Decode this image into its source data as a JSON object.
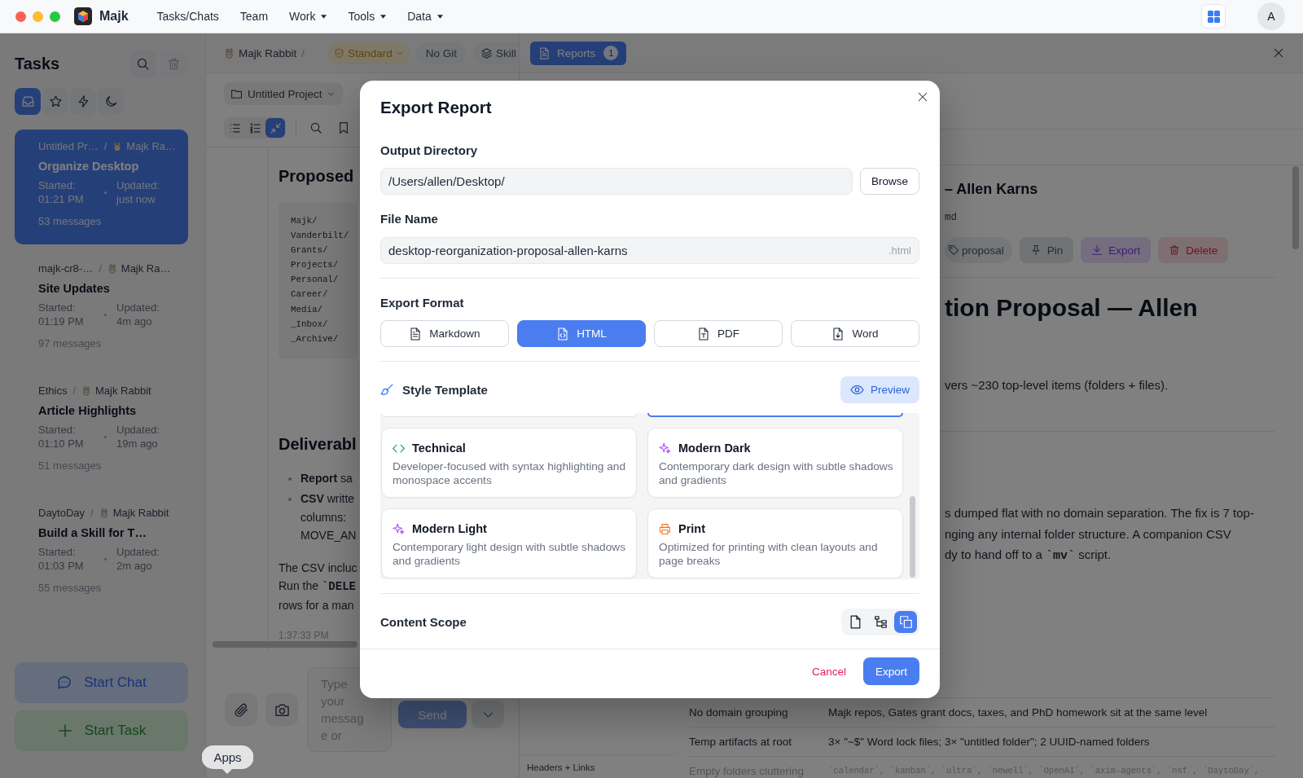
{
  "window": {
    "app_name": "Majk",
    "menu": [
      {
        "label": "Tasks/Chats",
        "dropdown": false
      },
      {
        "label": "Team",
        "dropdown": false
      },
      {
        "label": "Work",
        "dropdown": true
      },
      {
        "label": "Tools",
        "dropdown": true
      },
      {
        "label": "Data",
        "dropdown": true
      }
    ],
    "avatar": "A"
  },
  "sidebar": {
    "title": "Tasks",
    "header_actions": [
      {
        "kind": "search",
        "disabled": false
      },
      {
        "kind": "trash",
        "disabled": true
      }
    ],
    "filters": [
      {
        "kind": "tray",
        "selected": true
      },
      {
        "kind": "star",
        "selected": false
      },
      {
        "kind": "bolt",
        "selected": false
      },
      {
        "kind": "moon",
        "selected": false
      }
    ],
    "tasks": [
      {
        "project": "Untitled Pr…",
        "separator": "/",
        "agent": "Majk Ra…",
        "title": "Organize Desktop",
        "started": "Started: 01:21 PM",
        "updated": "Updated: just now",
        "messages": "53 messages",
        "selected": true
      },
      {
        "project": "majk-cr8-…",
        "separator": "/",
        "agent": "Majk Ra…",
        "title": "Site Updates",
        "started": "Started: 01:19 PM",
        "updated": "Updated: 4m ago",
        "messages": "97 messages",
        "selected": false
      },
      {
        "project": "Ethics",
        "separator": "/",
        "agent": "Majk Rabbit",
        "title": "Article Highlights",
        "started": "Started: 01:10 PM",
        "updated": "Updated: 19m ago",
        "messages": "51 messages",
        "selected": false
      },
      {
        "project": "DaytoDay",
        "separator": "/",
        "agent": "Majk Rabbit",
        "title": "Build a Skill for T…",
        "started": "Started: 01:03 PM",
        "updated": "Updated: 2m ago",
        "messages": "55 messages",
        "selected": false
      }
    ],
    "actions": [
      {
        "kind": "chat",
        "label": "Start Chat"
      },
      {
        "kind": "task",
        "label": "Start Task"
      }
    ]
  },
  "chat": {
    "breadcrumb": {
      "agent": "Majk Rabbit",
      "separator": "/"
    },
    "mode": "Standard",
    "pills": [
      {
        "kind": "git",
        "label": "No Git"
      },
      {
        "kind": "skill",
        "label": "Skill"
      }
    ],
    "project": "Untitled Project",
    "view_modes": [
      {
        "kind": "bullet-list",
        "selected": false
      },
      {
        "kind": "numbered-list",
        "selected": false
      },
      {
        "kind": "collapse",
        "selected": true
      }
    ],
    "tools": [
      {
        "kind": "search"
      },
      {
        "kind": "bookmark"
      }
    ],
    "message": {
      "heading": "Proposed",
      "code_lines": [
        "Majk/",
        "Vanderbilt/",
        "Grants/",
        "Projects/",
        "Personal/",
        "Career/",
        "Media/",
        "_Inbox/",
        "_Archive/"
      ],
      "subheading": "Deliverabl",
      "bullets": [
        {
          "lines": [
            "**Report** sa"
          ]
        },
        {
          "lines": [
            "**CSV** writte",
            "columns:",
            "MOVE_AN"
          ]
        }
      ],
      "paragraph_lines": [
        "The CSV incluc",
        "Run the **`DELE**",
        "rows for a man"
      ],
      "time": "1:37:33 PM"
    },
    "composer": {
      "placeholder": "Type your message or",
      "send": {
        "label": "Send",
        "disabled": true
      }
    }
  },
  "tooltip": "Apps",
  "reports": {
    "tab": {
      "label": "Reports",
      "count": "1",
      "selected": true
    },
    "title": "– Allen Karns",
    "file": "md",
    "actions": [
      {
        "kind": "tag",
        "label": "proposal"
      },
      {
        "kind": "pin",
        "label": "Pin"
      },
      {
        "kind": "export",
        "label": "Export"
      },
      {
        "kind": "delete",
        "label": "Delete"
      }
    ],
    "heading": "tion Proposal — Allen",
    "summary": "vers ~230 top-level items (folders + files).",
    "paragraph_lines": [
      "s dumped flat with no domain separation. The fix is 7 top-",
      "nging any internal folder structure. A companion CSV",
      "dy to hand off to a **`mv`** script."
    ],
    "table_rows": [
      {
        "kind": "text",
        "label": "No domain grouping",
        "detail": "Majk repos, Gates grant docs, taxes, and PhD homework sit at the same level",
        "faded": false
      },
      {
        "kind": "text",
        "label": "Temp artifacts at root",
        "detail": "3× \"~$\" Word lock files; 3× \"untitled folder\"; 2 UUID-named folders",
        "faded": false
      },
      {
        "kind": "code",
        "label": "Empty folders cluttering",
        "detail": "`calendar`, `kanban`, `ultra`, `newell`, `OpenAI`, `axim-agents`, `nsf`, `DaytoDay`,",
        "faded": true
      }
    ],
    "outline_item": "Headers + Links"
  },
  "dialog": {
    "title": "Export Report",
    "output_directory": {
      "label": "Output Directory",
      "value": "/Users/allen/Desktop/",
      "button": "Browse"
    },
    "file_name": {
      "label": "File Name",
      "value": "desktop-reorganization-proposal-allen-karns",
      "suffix": ".html"
    },
    "export_format": {
      "label": "Export Format",
      "options": [
        {
          "kind": "markdown",
          "label": "Markdown",
          "selected": false
        },
        {
          "kind": "html",
          "label": "HTML",
          "selected": true
        },
        {
          "kind": "pdf",
          "label": "PDF",
          "selected": false
        },
        {
          "kind": "word",
          "label": "Word",
          "selected": false
        }
      ]
    },
    "style_template": {
      "label": "Style Template",
      "preview": "Preview",
      "partial_cards": [
        {
          "selected": false
        },
        {
          "selected": true
        }
      ],
      "templates": [
        {
          "kind": "code",
          "name": "Technical",
          "description": "Developer-focused with syntax highlighting and monospace accents",
          "selected": false
        },
        {
          "kind": "sparkle",
          "name": "Modern Dark",
          "description": "Contemporary dark design with subtle shadows and gradients",
          "selected": false
        },
        {
          "kind": "sparkle",
          "name": "Modern Light",
          "description": "Contemporary light design with subtle shadows and gradients",
          "selected": false
        },
        {
          "kind": "printer",
          "name": "Print",
          "description": "Optimized for printing with clean layouts and page breaks",
          "selected": false
        }
      ]
    },
    "content_scope": {
      "label": "Content Scope",
      "options": [
        {
          "kind": "file",
          "selected": false
        },
        {
          "kind": "tree",
          "selected": false
        },
        {
          "kind": "copy",
          "selected": true
        }
      ]
    },
    "cancel": "Cancel",
    "export": "Export"
  }
}
